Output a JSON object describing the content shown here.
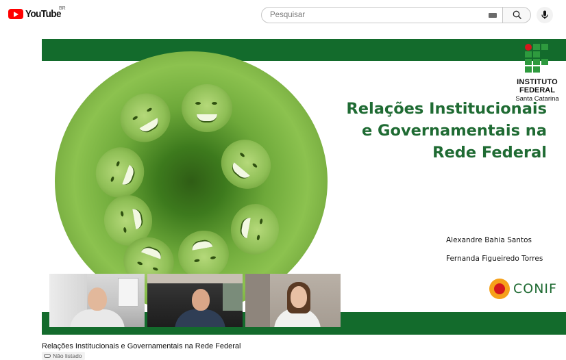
{
  "header": {
    "logo_text": "YouTube",
    "country_code": "BR",
    "search_placeholder": "Pesquisar",
    "icons": [
      "keyboard-icon",
      "search-icon",
      "mic-icon"
    ]
  },
  "slide": {
    "institution_line1": "INSTITUTO",
    "institution_line2": "FEDERAL",
    "institution_line3": "Santa Catarina",
    "title_lines": [
      "Relações Institucionais",
      "e Governamentais na",
      "Rede Federal"
    ],
    "authors": [
      "Alexandre Bahia Santos",
      "Fernanda Figueiredo Torres"
    ],
    "partner_logo_text": "CONIF",
    "colors": {
      "green_band": "#136b2c",
      "title_green": "#1f6b33",
      "accent_red": "#d5171d"
    }
  },
  "video": {
    "title": "Relações Institucionais e Governamentais na Rede Federal",
    "visibility_badge": "Não listado"
  }
}
